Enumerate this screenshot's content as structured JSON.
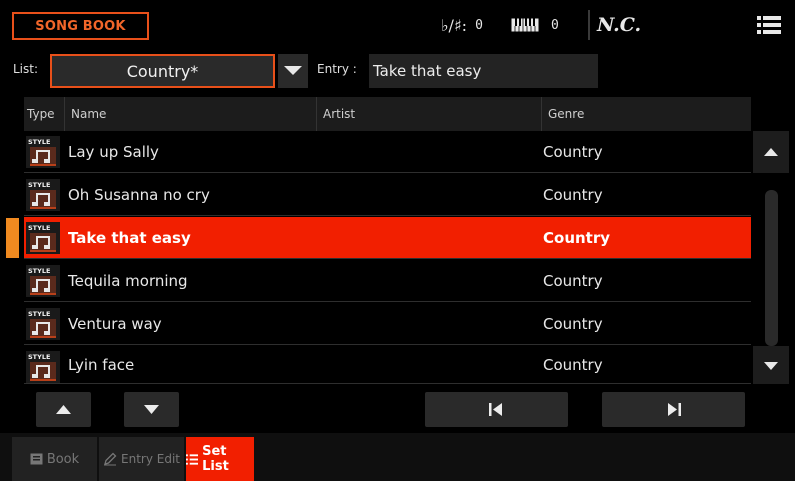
{
  "header": {
    "page_title": "SONG BOOK",
    "transpose_label": "♭/♯:",
    "transpose_value": "0",
    "octave_value": "0",
    "chord": "N.C."
  },
  "list_selector": {
    "label": "List:",
    "value": "Country*"
  },
  "entry": {
    "label": "Entry :",
    "value": "Take that easy"
  },
  "table": {
    "columns": [
      "Type",
      "Name",
      "Artist",
      "Genre"
    ],
    "type_icon_label": "STYLE",
    "rows": [
      {
        "name": "Lay up Sally",
        "artist": "",
        "genre": "Country"
      },
      {
        "name": "Oh Susanna no cry",
        "artist": "",
        "genre": "Country"
      },
      {
        "name": "Take that easy",
        "artist": "",
        "genre": "Country"
      },
      {
        "name": "Tequila morning",
        "artist": "",
        "genre": "Country"
      },
      {
        "name": "Ventura way",
        "artist": "",
        "genre": "Country"
      },
      {
        "name": "Lyin face",
        "artist": "",
        "genre": "Country"
      }
    ],
    "selected_row": 2
  },
  "footer_tabs": [
    {
      "label": "Book",
      "icon": "book-icon",
      "active": false
    },
    {
      "label": "Entry Edit",
      "icon": "pencil-icon",
      "active": false
    },
    {
      "label": "Set List",
      "icon": "list-icon",
      "active": true
    }
  ],
  "colors": {
    "accent": "#f21f00",
    "accent_outline": "#e8501a",
    "selection_marker": "#f08a20"
  }
}
